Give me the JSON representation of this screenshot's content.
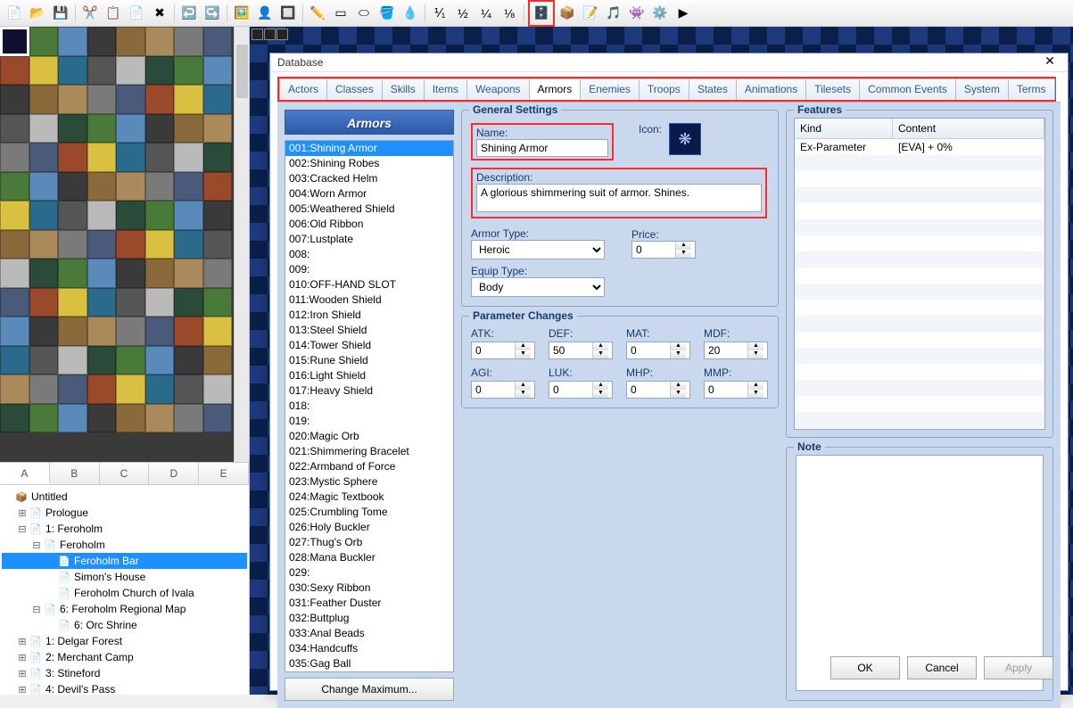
{
  "toolbar": {
    "icons": [
      "📄",
      "📂",
      "💾",
      "|",
      "✂️",
      "📋",
      "📄",
      "✖",
      "|",
      "↩️",
      "↪️",
      "|",
      "🖼️",
      "👤",
      "🔲",
      "|",
      "✏️",
      "▭",
      "⬭",
      "🪣",
      "💧",
      "|",
      "⅟₁",
      "½",
      "¼",
      "⅛",
      "|",
      "[DB]",
      "📦",
      "📝",
      "🎵",
      "👾",
      "⚙️",
      "▶"
    ]
  },
  "letterTabs": [
    "A",
    "B",
    "C",
    "D",
    "E"
  ],
  "tree": [
    {
      "ind": 0,
      "exp": "",
      "ico": "📦",
      "label": "Untitled"
    },
    {
      "ind": 1,
      "exp": "⊞",
      "ico": "📄",
      "label": "Prologue"
    },
    {
      "ind": 1,
      "exp": "⊟",
      "ico": "📄",
      "label": "1: Feroholm"
    },
    {
      "ind": 2,
      "exp": "⊟",
      "ico": "📄",
      "label": "Feroholm"
    },
    {
      "ind": 3,
      "exp": "",
      "ico": "📄",
      "label": "Feroholm Bar",
      "sel": true
    },
    {
      "ind": 3,
      "exp": "",
      "ico": "📄",
      "label": "Simon's House"
    },
    {
      "ind": 3,
      "exp": "",
      "ico": "📄",
      "label": "Feroholm Church of Ivala"
    },
    {
      "ind": 2,
      "exp": "⊟",
      "ico": "📄",
      "label": "6: Feroholm Regional Map"
    },
    {
      "ind": 3,
      "exp": "",
      "ico": "📄",
      "label": "6: Orc Shrine"
    },
    {
      "ind": 1,
      "exp": "⊞",
      "ico": "📄",
      "label": "1: Delgar Forest"
    },
    {
      "ind": 1,
      "exp": "⊞",
      "ico": "📄",
      "label": "2: Merchant Camp"
    },
    {
      "ind": 1,
      "exp": "⊞",
      "ico": "📄",
      "label": "3: Stineford"
    },
    {
      "ind": 1,
      "exp": "⊞",
      "ico": "📄",
      "label": "4: Devil's Pass"
    }
  ],
  "dialog": {
    "title": "Database",
    "tabs": [
      "Actors",
      "Classes",
      "Skills",
      "Items",
      "Weapons",
      "Armors",
      "Enemies",
      "Troops",
      "States",
      "Animations",
      "Tilesets",
      "Common Events",
      "System",
      "Terms"
    ],
    "activeTab": "Armors",
    "listHeader": "Armors",
    "items": [
      "001:Shining Armor",
      "002:Shining Robes",
      "003:Cracked Helm",
      "004:Worn Armor",
      "005:Weathered Shield",
      "006:Old Ribbon",
      "007:Lustplate",
      "008:",
      "009:",
      "010:OFF-HAND SLOT",
      "011:Wooden Shield",
      "012:Iron Shield",
      "013:Steel Shield",
      "014:Tower Shield",
      "015:Rune Shield",
      "016:Light Shield",
      "017:Heavy Shield",
      "018:",
      "019:",
      "020:Magic Orb",
      "021:Shimmering Bracelet",
      "022:Armband of Force",
      "023:Mystic Sphere",
      "024:Magic Textbook",
      "025:Crumbling Tome",
      "026:Holy Buckler",
      "027:Thug's Orb",
      "028:Mana Buckler",
      "029:",
      "030:Sexy Ribbon",
      "031:Feather Duster",
      "032:Buttplug",
      "033:Anal Beads",
      "034:Handcuffs",
      "035:Gag Ball"
    ],
    "changeMax": "Change Maximum...",
    "general": {
      "title": "General Settings",
      "nameLabel": "Name:",
      "name": "Shining Armor",
      "iconLabel": "Icon:",
      "descLabel": "Description:",
      "desc": "A glorious shimmering suit of armor. Shines.",
      "armorTypeLabel": "Armor Type:",
      "armorType": "Heroic",
      "priceLabel": "Price:",
      "price": "0",
      "equipTypeLabel": "Equip Type:",
      "equipType": "Body"
    },
    "params": {
      "title": "Parameter Changes",
      "labels": {
        "atk": "ATK:",
        "def": "DEF:",
        "mat": "MAT:",
        "mdf": "MDF:",
        "agi": "AGI:",
        "luk": "LUK:",
        "mhp": "MHP:",
        "mmp": "MMP:"
      },
      "values": {
        "atk": "0",
        "def": "50",
        "mat": "0",
        "mdf": "20",
        "agi": "0",
        "luk": "0",
        "mhp": "0",
        "mmp": "0"
      }
    },
    "features": {
      "title": "Features",
      "headKind": "Kind",
      "headContent": "Content",
      "rows": [
        {
          "kind": "Ex-Parameter",
          "content": "[EVA] + 0%"
        }
      ]
    },
    "note": {
      "title": "Note"
    },
    "buttons": {
      "ok": "OK",
      "cancel": "Cancel",
      "apply": "Apply"
    }
  }
}
